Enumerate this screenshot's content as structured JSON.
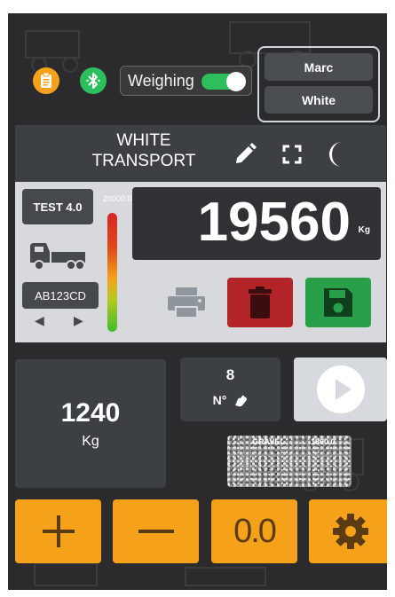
{
  "top_bar": {
    "weighing_label": "Weighing",
    "weighing_enabled": true,
    "user": {
      "first_name": "Marc",
      "last_name": "White"
    }
  },
  "header": {
    "company_line1": "WHITE",
    "company_line2": "TRANSPORT"
  },
  "scale": {
    "test_label": "TEST 4.0",
    "gauge_max": "20000.0",
    "plate": "AB123CD",
    "weight": "19560",
    "unit": "Kg"
  },
  "tare": {
    "value": "1240",
    "unit": "Kg"
  },
  "counter": {
    "value": "8",
    "label": "N°"
  },
  "material": {
    "name": "GRAVEL",
    "price": "1800.0"
  },
  "bottom": {
    "zero_label": "0.0"
  },
  "colors": {
    "background": "#2b2b2d",
    "accent_orange": "#f5a21a",
    "delete_red": "#b22428",
    "save_green": "#2a9f4a",
    "bluetooth_green": "#2dbf5c"
  },
  "icons": [
    "clipboard-icon",
    "bluetooth-icon",
    "pencil-icon",
    "fullscreen-icon",
    "moon-icon",
    "truck-icon",
    "printer-icon",
    "trash-icon",
    "save-icon",
    "play-icon",
    "plus-icon",
    "minus-icon",
    "gear-icon",
    "hand-icon"
  ]
}
